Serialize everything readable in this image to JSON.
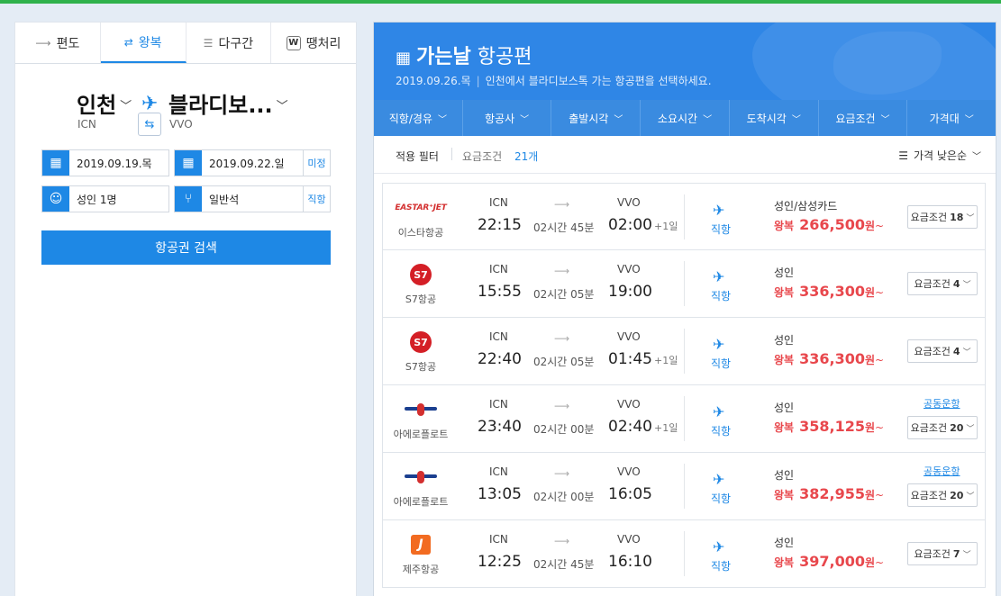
{
  "trip_tabs": [
    {
      "icon": "arrow-right-icon",
      "glyph": "⟶",
      "label": "편도"
    },
    {
      "icon": "round-trip-icon",
      "glyph": "⇄",
      "label": "왕복"
    },
    {
      "icon": "multi-city-icon",
      "glyph": "☰",
      "label": "다구간"
    },
    {
      "icon": "w-badge-icon",
      "glyph": "W",
      "label": "땡처리"
    }
  ],
  "route": {
    "origin_city": "인천",
    "origin_code": "ICN",
    "dest_city": "블라디보...",
    "dest_code": "VVO"
  },
  "form": {
    "depart_date": "2019.09.19.목",
    "return_date": "2019.09.22.일",
    "return_suffix": "미정",
    "passengers": "성인 1명",
    "cabin": "일반석",
    "cabin_suffix": "직항",
    "search_label": "항공권 검색"
  },
  "banner": {
    "title_bold": "가는날",
    "title_rest": " 항공편",
    "date": "2019.09.26.목",
    "description": "인천에서 블라디보스톡 가는 항공편을 선택하세요."
  },
  "filters": [
    "직항/경유",
    "항공사",
    "출발시각",
    "소요시간",
    "도착시각",
    "요금조건",
    "가격대"
  ],
  "applied": {
    "label": "적용 필터",
    "filter_name": "요금조건",
    "filter_count": "21개",
    "sort_label": "가격 낮은순"
  },
  "flights": [
    {
      "logo": "eastar",
      "logo_text": "EASTAR⁺JET",
      "airline": "이스타항공",
      "dep_code": "ICN",
      "dep_time": "22:15",
      "duration": "02시간 45분",
      "arr_code": "VVO",
      "arr_time": "02:00",
      "plus_day": "+1일",
      "direct": "직항",
      "pax": "성인/삼성카드",
      "trip": "왕복",
      "price": "266,500",
      "won": "원",
      "tilde": "~",
      "codeshare": "",
      "cond_label": "요금조건",
      "cond_count": "18"
    },
    {
      "logo": "s7",
      "logo_text": "S7",
      "airline": "S7항공",
      "dep_code": "ICN",
      "dep_time": "15:55",
      "duration": "02시간 05분",
      "arr_code": "VVO",
      "arr_time": "19:00",
      "plus_day": "",
      "direct": "직항",
      "pax": "성인",
      "trip": "왕복",
      "price": "336,300",
      "won": "원",
      "tilde": "~",
      "codeshare": "",
      "cond_label": "요금조건",
      "cond_count": "4"
    },
    {
      "logo": "s7",
      "logo_text": "S7",
      "airline": "S7항공",
      "dep_code": "ICN",
      "dep_time": "22:40",
      "duration": "02시간 05분",
      "arr_code": "VVO",
      "arr_time": "01:45",
      "plus_day": "+1일",
      "direct": "직항",
      "pax": "성인",
      "trip": "왕복",
      "price": "336,300",
      "won": "원",
      "tilde": "~",
      "codeshare": "",
      "cond_label": "요금조건",
      "cond_count": "4"
    },
    {
      "logo": "aero",
      "logo_text": "",
      "airline": "아에로플로트",
      "dep_code": "ICN",
      "dep_time": "23:40",
      "duration": "02시간 00분",
      "arr_code": "VVO",
      "arr_time": "02:40",
      "plus_day": "+1일",
      "direct": "직항",
      "pax": "성인",
      "trip": "왕복",
      "price": "358,125",
      "won": "원",
      "tilde": "~",
      "codeshare": "공동운항",
      "cond_label": "요금조건",
      "cond_count": "20"
    },
    {
      "logo": "aero",
      "logo_text": "",
      "airline": "아에로플로트",
      "dep_code": "ICN",
      "dep_time": "13:05",
      "duration": "02시간 00분",
      "arr_code": "VVO",
      "arr_time": "16:05",
      "plus_day": "",
      "direct": "직항",
      "pax": "성인",
      "trip": "왕복",
      "price": "382,955",
      "won": "원",
      "tilde": "~",
      "codeshare": "공동운항",
      "cond_label": "요금조건",
      "cond_count": "20"
    },
    {
      "logo": "jeju",
      "logo_text": "J",
      "airline": "제주항공",
      "dep_code": "ICN",
      "dep_time": "12:25",
      "duration": "02시간 45분",
      "arr_code": "VVO",
      "arr_time": "16:10",
      "plus_day": "",
      "direct": "직항",
      "pax": "성인",
      "trip": "왕복",
      "price": "397,000",
      "won": "원",
      "tilde": "~",
      "codeshare": "",
      "cond_label": "요금조건",
      "cond_count": "7"
    }
  ],
  "colors": {
    "accent": "#1e88e5",
    "banner": "#2f86e6",
    "filter_bar": "#3a8be0",
    "price": "#e8474c",
    "top_accent": "#2fb24c"
  }
}
